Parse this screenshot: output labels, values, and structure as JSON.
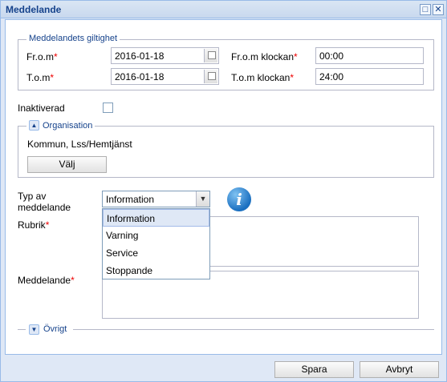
{
  "window": {
    "title": "Meddelande",
    "maximize_icon": "maximize-icon",
    "close_icon": "close-icon"
  },
  "validity": {
    "legend": "Meddelandets giltighet",
    "from_label": "Fr.o.m",
    "from_value": "2016-01-18",
    "to_label": "T.o.m",
    "to_value": "2016-01-18",
    "from_time_label": "Fr.o.m klockan",
    "from_time_value": "00:00",
    "to_time_label": "T.o.m klockan",
    "to_time_value": "24:00",
    "required_mark": "*"
  },
  "inactivated": {
    "label": "Inaktiverad",
    "checked": false
  },
  "organisation": {
    "legend": "Organisation",
    "value": "Kommun, Lss/Hemtjänst",
    "choose_button": "Välj"
  },
  "message_type": {
    "label_line1": "Typ av",
    "label_line2": "meddelande",
    "selected": "Information",
    "options": [
      "Information",
      "Varning",
      "Service",
      "Stoppande"
    ]
  },
  "rubrik": {
    "label": "Rubrik",
    "value": ""
  },
  "meddelande": {
    "label": "Meddelande",
    "value": ""
  },
  "ovrigt": {
    "legend": "Övrigt"
  },
  "footer": {
    "save_button": "Spara",
    "cancel_button": "Avbryt"
  },
  "colors": {
    "accent": "#15428b",
    "required": "#e00000",
    "selected_bg": "#dfe8f6"
  }
}
